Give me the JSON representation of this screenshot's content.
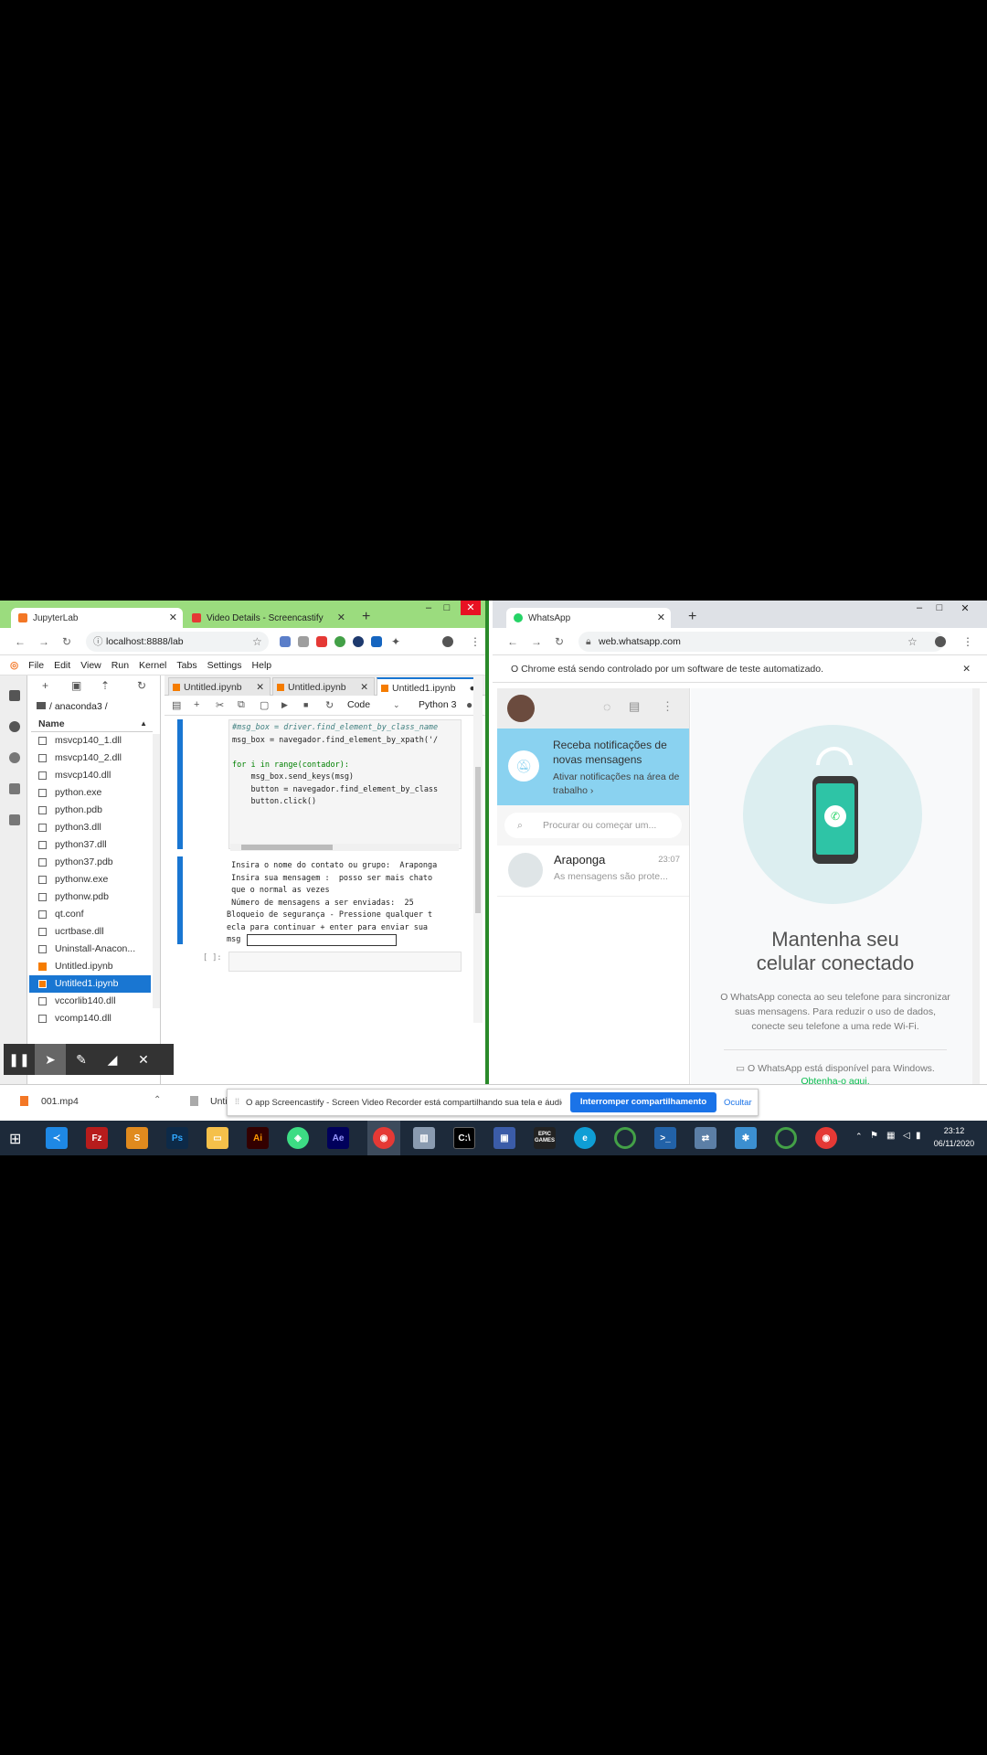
{
  "left_window": {
    "tabs": [
      {
        "label": "JupyterLab",
        "active": true
      },
      {
        "label": "Video Details - Screencastify",
        "active": false
      }
    ],
    "url": "localhost:8888/lab",
    "menu": [
      "File",
      "Edit",
      "View",
      "Run",
      "Kernel",
      "Tabs",
      "Settings",
      "Help"
    ],
    "file_browser": {
      "path": "/ anaconda3 /",
      "column": "Name",
      "files": [
        {
          "name": "msvcp140_1.dll",
          "type": "file"
        },
        {
          "name": "msvcp140_2.dll",
          "type": "file"
        },
        {
          "name": "msvcp140.dll",
          "type": "file"
        },
        {
          "name": "python.exe",
          "type": "file"
        },
        {
          "name": "python.pdb",
          "type": "file"
        },
        {
          "name": "python3.dll",
          "type": "file"
        },
        {
          "name": "python37.dll",
          "type": "file"
        },
        {
          "name": "python37.pdb",
          "type": "file"
        },
        {
          "name": "pythonw.exe",
          "type": "file"
        },
        {
          "name": "pythonw.pdb",
          "type": "file"
        },
        {
          "name": "qt.conf",
          "type": "file"
        },
        {
          "name": "ucrtbase.dll",
          "type": "file"
        },
        {
          "name": "Uninstall-Anacon...",
          "type": "file"
        },
        {
          "name": "Untitled.ipynb",
          "type": "notebook"
        },
        {
          "name": "Untitled1.ipynb",
          "type": "notebook",
          "selected": true
        },
        {
          "name": "vccorlib140.dll",
          "type": "file"
        },
        {
          "name": "vcomp140.dll",
          "type": "file"
        }
      ]
    },
    "notebook_tabs": [
      "Untitled.ipynb",
      "Untitled.ipynb",
      "Untitled1.ipynb"
    ],
    "cell_type": "Code",
    "kernel": "Python 3",
    "code_lines": [
      {
        "text": "#msg_box = driver.find_element_by_class_name",
        "kind": "comment"
      },
      {
        "text": "msg_box = navegador.find_element_by_xpath('/",
        "kind": "code"
      },
      {
        "text": "",
        "kind": "code"
      },
      {
        "text": "for i in range(contador):",
        "kind": "loop"
      },
      {
        "text": "    msg_box.send_keys(msg)",
        "kind": "code"
      },
      {
        "text": "    button = navegador.find_element_by_class",
        "kind": "code"
      },
      {
        "text": "    button.click()",
        "kind": "code"
      }
    ],
    "output_lines": [
      " Insira o nome do contato ou grupo:  Araponga",
      " Insira sua mensagem :  posso ser mais chato",
      " que o normal as vezes",
      " Número de mensagens a ser enviadas:  25",
      "Bloqueio de segurança - Pressione qualquer t",
      "ecla para continuar + enter para enviar sua",
      "msg "
    ],
    "empty_prompt": "[ ]:"
  },
  "right_window": {
    "tab": "WhatsApp",
    "url": "web.whatsapp.com",
    "automation_notice": "O Chrome está sendo controlado por um software de teste automatizado.",
    "notify_title": "Receba notificações de novas mensagens",
    "notify_link": "Ativar notificações na área de trabalho",
    "search_placeholder": "Procurar ou começar um...",
    "chat": {
      "name": "Araponga",
      "time": "23:07",
      "preview": "As mensagens são prote..."
    },
    "main_title": "Mantenha seu celular conectado",
    "main_text": "O WhatsApp conecta ao seu telefone para sincronizar suas mensagens. Para reduzir o uso de dados, conecte seu telefone a uma rede Wi-Fi.",
    "windows_text": "O WhatsApp está disponível para Windows.",
    "windows_link": "Obtenha-o aqui."
  },
  "download": {
    "file": "001.mp4",
    "file2": "Unti"
  },
  "share_bar": {
    "text": "O app Screencastify - Screen Video Recorder está compartilhando sua tela e áudio.",
    "stop_button": "Interromper compartilhamento",
    "hide_button": "Ocultar"
  },
  "taskbar": {
    "apps": [
      "VS Code",
      "FileZilla",
      "Sublime",
      "Ps",
      "Explorer",
      "Ai",
      "Android Studio",
      "Ae",
      "Chrome",
      "App",
      "Terminal",
      "App",
      "Epic Games",
      "Edge",
      "App",
      "PowerShell",
      "App",
      "App",
      "Chrome"
    ],
    "epic_label": "EPIC\nGAMES",
    "time": "23:12",
    "date": "06/11/2020"
  },
  "colors": {
    "jupyter_blue": "#1976d2",
    "whatsapp_green": "#4adf83",
    "notify_blue": "#8ad2f0",
    "share_button": "#1a73e8",
    "taskbar": "#1d2a3a"
  }
}
